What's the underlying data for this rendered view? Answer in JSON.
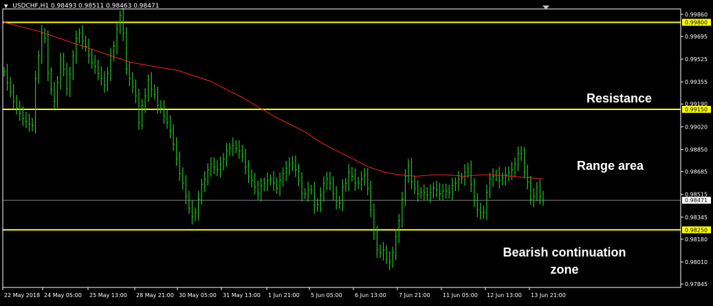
{
  "header": {
    "symbol": "USDCHF,H1",
    "ohlc": "0.98493 0.98511 0.98463 0.98471"
  },
  "colors": {
    "background": "#000000",
    "bars": "#22c722",
    "moving_average": "#ff2020",
    "levels": "#ffff00",
    "current_price_line": "#808080",
    "axis_text": "#ffffff"
  },
  "annotations": {
    "resistance": "Resistance",
    "range": "Range area",
    "bearish_line1": "Bearish continuation",
    "bearish_line2": "zone"
  },
  "chart_data": {
    "type": "line",
    "title": "USDCHF,H1",
    "y_ticks": [
      "0.99860",
      "0.99695",
      "0.99525",
      "0.99355",
      "0.99190",
      "0.99020",
      "0.98850",
      "0.98685",
      "0.98515",
      "0.98345",
      "0.98180",
      "0.98010",
      "0.97845"
    ],
    "y_tick_values": [
      0.9986,
      0.99695,
      0.99525,
      0.99355,
      0.9919,
      0.9902,
      0.9885,
      0.98685,
      0.98515,
      0.98345,
      0.9818,
      0.9801,
      0.97845
    ],
    "ylim": [
      0.9782,
      0.999
    ],
    "x_ticks": [
      "22 May 2018",
      "24 May 05:00",
      "25 May 13:00",
      "28 May 21:00",
      "30 May 05:00",
      "31 May 13:00",
      "1 Jun 21:00",
      "5 Jun 05:00",
      "6 Jun 13:00",
      "7 Jun 21:00",
      "11 Jun 05:00",
      "12 Jun 13:00",
      "13 Jun 21:00"
    ],
    "levels": [
      {
        "label": "0.99800",
        "value": 0.998
      },
      {
        "label": "0.99150",
        "value": 0.9915
      },
      {
        "label": "0.98250",
        "value": 0.9825
      }
    ],
    "current_price": {
      "label": "0.98471",
      "value": 0.98471
    },
    "series": [
      {
        "values": [
          0.9943,
          0.9935,
          0.9928,
          0.9921,
          0.9916,
          0.9912,
          0.9908,
          0.9906,
          0.9904,
          0.9903,
          0.9938,
          0.9955,
          0.9972,
          0.9968,
          0.9942,
          0.993,
          0.9921,
          0.9935,
          0.9952,
          0.9945,
          0.993,
          0.9941,
          0.9955,
          0.9968,
          0.9972,
          0.9966,
          0.9962,
          0.9955,
          0.995,
          0.9947,
          0.9942,
          0.9938,
          0.9933,
          0.9942,
          0.9955,
          0.9962,
          0.9975,
          0.9985,
          0.9972,
          0.9945,
          0.9938,
          0.9932,
          0.9925,
          0.9905,
          0.9918,
          0.9925,
          0.9937,
          0.993,
          0.9926,
          0.9918,
          0.9916,
          0.991,
          0.9905,
          0.9899,
          0.9889,
          0.9878,
          0.9867,
          0.986,
          0.985,
          0.9841,
          0.9835,
          0.9838,
          0.9848,
          0.9859,
          0.9863,
          0.987,
          0.9874,
          0.9872,
          0.987,
          0.9874,
          0.9878,
          0.9884,
          0.9886,
          0.9888,
          0.9886,
          0.9884,
          0.988,
          0.9872,
          0.9865,
          0.9862,
          0.9857,
          0.9852,
          0.9858,
          0.986,
          0.9862,
          0.9863,
          0.986,
          0.9856,
          0.9862,
          0.9867,
          0.9871,
          0.9874,
          0.9875,
          0.987,
          0.9862,
          0.9852,
          0.9852,
          0.9855,
          0.9855,
          0.9843,
          0.9844,
          0.9851,
          0.986,
          0.9863,
          0.986,
          0.9852,
          0.9846,
          0.9845,
          0.9857,
          0.986,
          0.9868,
          0.9865,
          0.986,
          0.986,
          0.9863,
          0.9866,
          0.9856,
          0.984,
          0.9822,
          0.981,
          0.9808,
          0.981,
          0.9803,
          0.9801,
          0.9808,
          0.982,
          0.9832,
          0.9848,
          0.9865,
          0.9873,
          0.9861,
          0.9856,
          0.9852,
          0.9853,
          0.9853,
          0.9851,
          0.9853,
          0.9856,
          0.9855,
          0.9852,
          0.9854,
          0.9854,
          0.9853,
          0.9858,
          0.986,
          0.9863,
          0.9864,
          0.9868,
          0.9871,
          0.9859,
          0.9847,
          0.984,
          0.9838,
          0.9838,
          0.9853,
          0.9863,
          0.9865,
          0.9866,
          0.9862,
          0.9864,
          0.9866,
          0.9868,
          0.987,
          0.9874,
          0.9882,
          0.9882,
          0.9868,
          0.9861,
          0.9848,
          0.985,
          0.9857,
          0.985,
          0.9847
        ]
      },
      {
        "values": [
          0.998,
          0.9977,
          0.9974,
          0.997,
          0.9966,
          0.9962,
          0.9958,
          0.9954,
          0.995,
          0.9948,
          0.9946,
          0.9944,
          0.994,
          0.9936,
          0.993,
          0.9924,
          0.9917,
          0.991,
          0.9904,
          0.9898,
          0.989,
          0.9884,
          0.9878,
          0.9872,
          0.9868,
          0.9866,
          0.9865,
          0.9866,
          0.9866,
          0.9865,
          0.9866,
          0.9866,
          0.9865,
          0.9864,
          0.9863
        ]
      }
    ],
    "grid": false
  }
}
